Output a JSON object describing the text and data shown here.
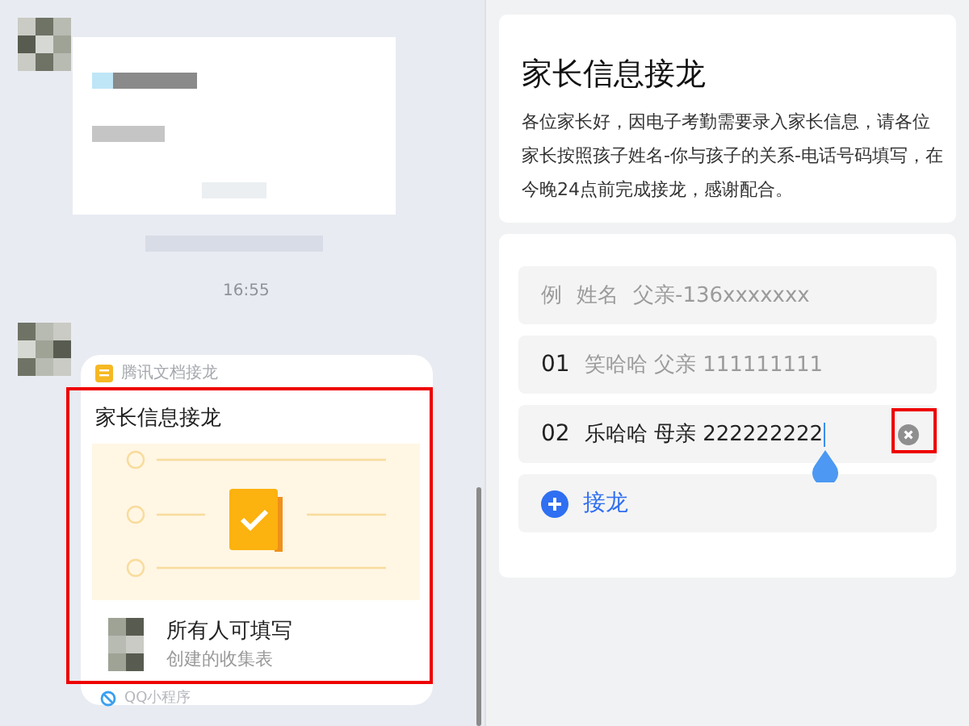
{
  "chat": {
    "time": "16:55",
    "card": {
      "source": "腾讯文档接龙",
      "title": "家长信息接龙",
      "subtitle": "所有人可填写",
      "caption": "创建的收集表",
      "footer": "QQ小程序"
    }
  },
  "form": {
    "title": "家长信息接龙",
    "description": "各位家长好，因电子考勤需要录入家长信息，请各位家长按照孩子姓名-你与孩子的关系-电话号码填写，在今晚24点前完成接龙，感谢配合。",
    "example": {
      "label": "例",
      "fields": [
        "姓名",
        "父亲-136xxxxxxx"
      ]
    },
    "entries": [
      {
        "number": "01",
        "value": "笑哈哈 父亲 111111111",
        "kind": "submitted"
      },
      {
        "number": "02",
        "value": "乐哈哈 母亲 222222222",
        "kind": "editing"
      }
    ],
    "add_button": "接龙"
  }
}
